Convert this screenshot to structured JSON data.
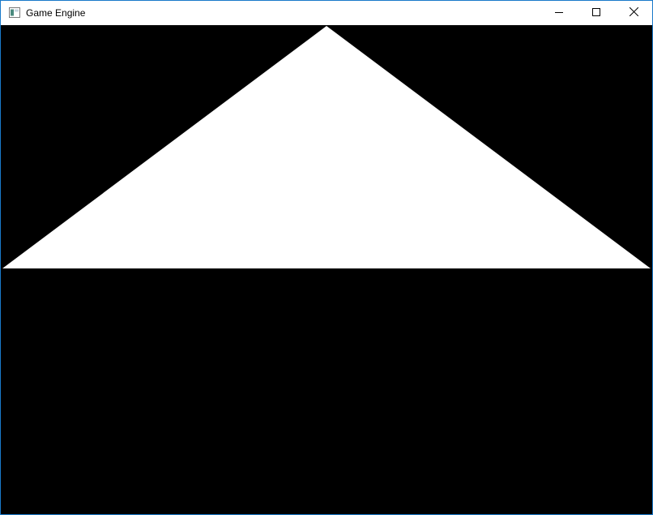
{
  "window": {
    "title": "Game Engine",
    "icons": {
      "app": "application-window-icon",
      "minimize": "minimize-icon",
      "maximize": "maximize-icon",
      "close": "close-icon"
    },
    "colors": {
      "titlebar": "#ffffff",
      "border": "#1979ca",
      "viewport_background": "#000000",
      "triangle_fill": "#ffffff"
    }
  }
}
